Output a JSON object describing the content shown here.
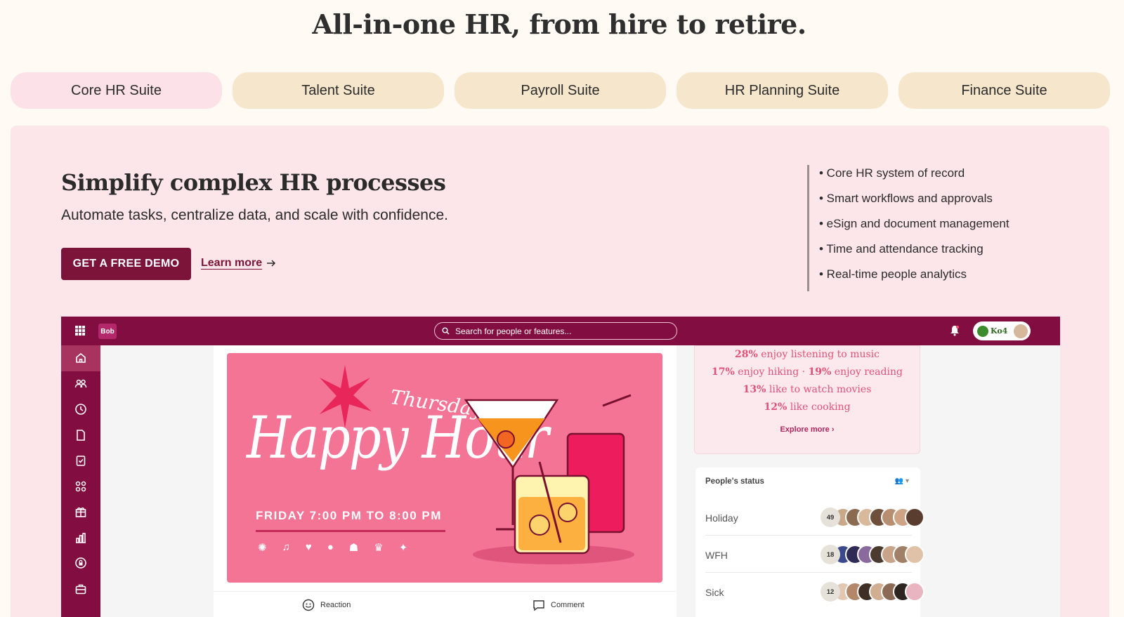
{
  "hero": {
    "title": "All-in-one HR, from hire to retire."
  },
  "tabs": [
    {
      "label": "Core HR Suite",
      "active": true
    },
    {
      "label": "Talent Suite"
    },
    {
      "label": "Payroll Suite"
    },
    {
      "label": "HR Planning Suite"
    },
    {
      "label": "Finance Suite"
    }
  ],
  "panel": {
    "title": "Simplify complex HR processes",
    "subtitle": "Automate tasks, centralize data, and scale with confidence.",
    "demo_button": "GET A FREE DEMO",
    "learn_more": "Learn more",
    "features": [
      "• Core HR system of record",
      "• Smart workflows and approvals",
      "• eSign and document management",
      "• Time and attendance tracking",
      "• Real-time people analytics"
    ]
  },
  "app": {
    "logo": "Bob",
    "search_placeholder": "Search for people or features...",
    "user_badge": "Ko4",
    "sidebar_icons": [
      "home-icon",
      "people-icon",
      "clock-icon",
      "document-icon",
      "clipboard-icon",
      "apps-icon",
      "gift-icon",
      "chart-icon",
      "lock-icon",
      "briefcase-icon"
    ],
    "banner": {
      "day": "Thursday",
      "title": "Happy Hour",
      "time": "FRIDAY 7:00 PM TO 8:00 PM",
      "icons": [
        "party-icon",
        "music-icon",
        "heart-icon",
        "burger-icon",
        "ghost-icon",
        "crown-icon",
        "confetti-icon"
      ]
    },
    "post_actions": {
      "reaction": "Reaction",
      "comment": "Comment"
    },
    "interests": {
      "line1_pct": "28%",
      "line1_text": " enjoy listening to music",
      "line2a_pct": "17%",
      "line2a_text": " enjoy hiking",
      "line2_sep": " · ",
      "line2b_pct": "19%",
      "line2b_text": " enjoy reading",
      "line3_pct": "13%",
      "line3_text": " like to watch movies",
      "line4_pct": "12%",
      "line4_text": " like cooking",
      "explore": "Explore more"
    },
    "status": {
      "title": "People's status",
      "rows": [
        {
          "label": "Holiday",
          "count": "49"
        },
        {
          "label": "WFH",
          "count": "18"
        },
        {
          "label": "Sick",
          "count": "12"
        }
      ]
    },
    "colors": {
      "brand": "#820d40",
      "accent_pink": "#f47496",
      "panel_bg": "#fde6ea",
      "tab_bg": "#f6e6cc"
    }
  }
}
